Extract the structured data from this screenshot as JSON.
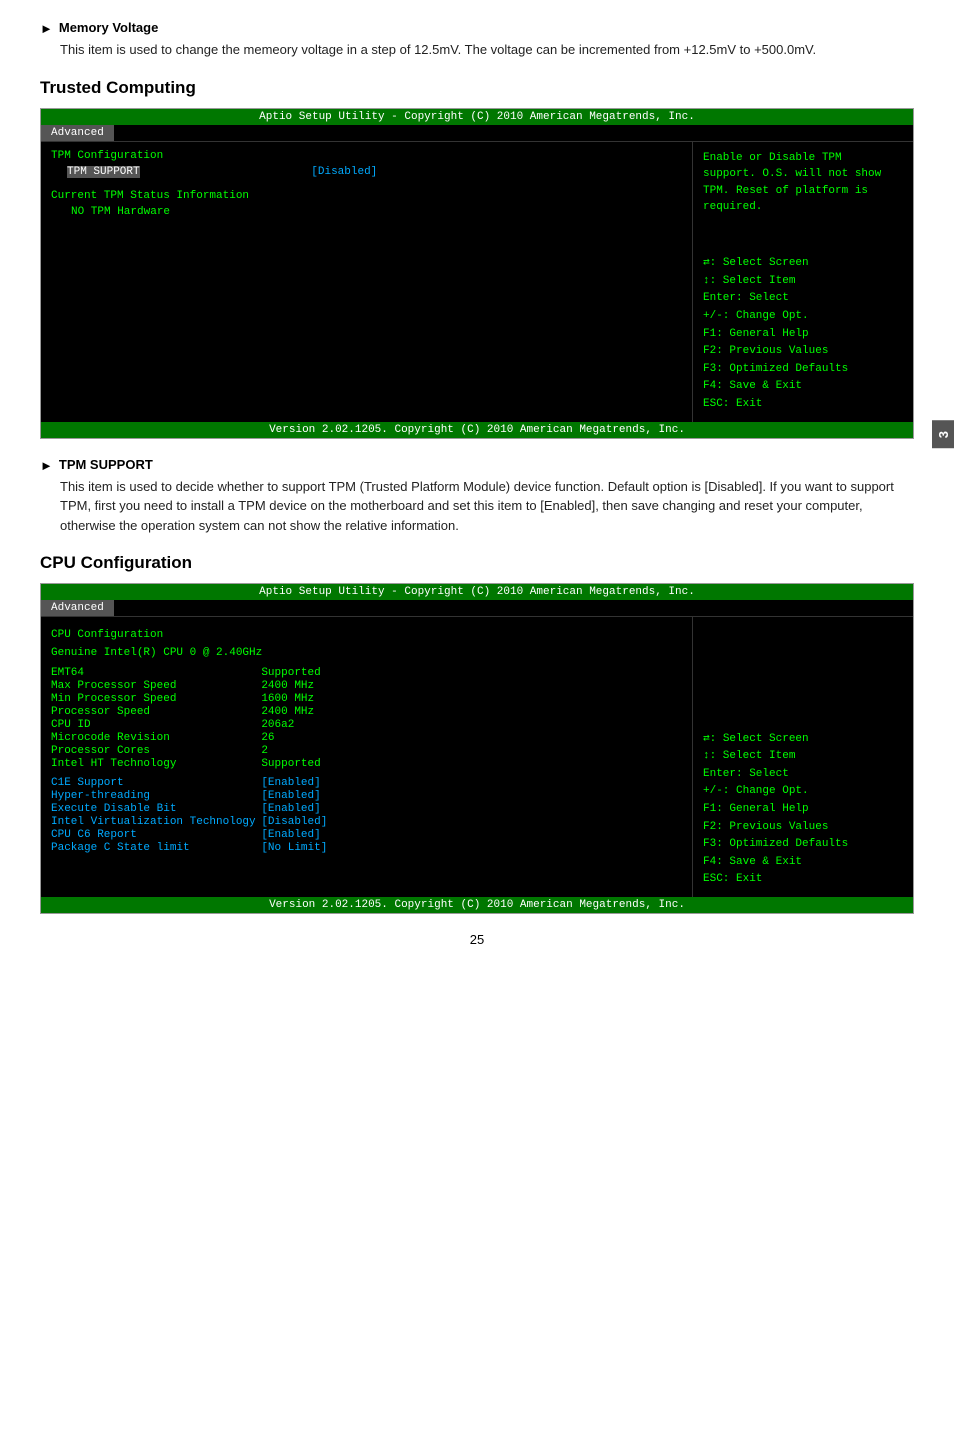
{
  "side_tab": "3",
  "memory_voltage": {
    "title": "Memory Voltage",
    "description": "This item is used to change the memeory voltage in a step of 12.5mV. The voltage can be incremented from +12.5mV to +500.0mV."
  },
  "trusted_computing": {
    "heading": "Trusted Computing",
    "bios": {
      "titlebar": "Aptio Setup Utility - Copyright (C) 2010 American Megatrends, Inc.",
      "tab": "Advanced",
      "left": {
        "section": "TPM Configuration",
        "items": [
          {
            "label": "TPM SUPPORT",
            "value": "[Disabled]",
            "highlighted": false,
            "blue": true
          },
          {
            "label": "Current TPM Status Information",
            "value": "",
            "highlighted": false
          },
          {
            "label": "    NO TPM Hardware",
            "value": "",
            "highlighted": false
          }
        ]
      },
      "right_top": "Enable or Disable TPM\nsupport. O.S. will not show\nTPM. Reset of platform is\nrequired.",
      "right_bottom": {
        "lines": [
          "↔: Select Screen",
          "↑↓: Select Item",
          "Enter: Select",
          "+/-: Change Opt.",
          "F1: General Help",
          "F2: Previous Values",
          "F3: Optimized Defaults",
          "F4: Save & Exit",
          "ESC: Exit"
        ]
      },
      "footer": "Version 2.02.1205. Copyright (C) 2010 American Megatrends, Inc."
    }
  },
  "tpm_support": {
    "title": "TPM SUPPORT",
    "description": "This item is used to decide whether to support TPM (Trusted Platform Module) device function.  Default option is [Disabled]. If you want to support TPM, first you need to install a TPM device on the motherboard and set this item to [Enabled], then save changing and reset your computer, otherwise the operation system can not show the relative information."
  },
  "cpu_configuration": {
    "heading": "CPU Configuration",
    "bios": {
      "titlebar": "Aptio Setup Utility - Copyright (C) 2010 American Megatrends, Inc.",
      "tab": "Advanced",
      "left": {
        "section_title": "CPU Configuration",
        "cpu_name": "Genuine Intel(R) CPU 0 @ 2.40GHz",
        "rows": [
          {
            "label": "EMT64",
            "value": "Supported"
          },
          {
            "label": "Max Processor Speed",
            "value": "2400 MHz"
          },
          {
            "label": "Min Processor Speed",
            "value": "1600 MHz"
          },
          {
            "label": "Processor Speed",
            "value": "2400 MHz"
          },
          {
            "label": "CPU ID",
            "value": "206a2"
          },
          {
            "label": "Microcode Revision",
            "value": "26"
          },
          {
            "label": "Processor Cores",
            "value": "2"
          },
          {
            "label": "Intel HT Technology",
            "value": "Supported"
          }
        ],
        "rows_highlighted": [
          {
            "label": "C1E Support",
            "value": "[Enabled]",
            "blue": true
          },
          {
            "label": "Hyper-threading",
            "value": "[Enabled]",
            "blue": true
          },
          {
            "label": "Execute Disable Bit",
            "value": "[Enabled]",
            "blue": true
          },
          {
            "label": "Intel Virtualization Technology",
            "value": "[Disabled]",
            "blue": true
          },
          {
            "label": "CPU C6 Report",
            "value": "[Enabled]",
            "blue": true
          },
          {
            "label": "Package C State limit",
            "value": "[No Limit]",
            "blue": true
          }
        ]
      },
      "right_bottom": {
        "lines": [
          "↔: Select Screen",
          "↑↓: Select Item",
          "Enter: Select",
          "+/-: Change Opt.",
          "F1: General Help",
          "F2: Previous Values",
          "F3: Optimized Defaults",
          "F4: Save & Exit",
          "ESC: Exit"
        ]
      },
      "footer": "Version 2.02.1205. Copyright (C) 2010 American Megatrends, Inc."
    }
  },
  "page_number": "25"
}
